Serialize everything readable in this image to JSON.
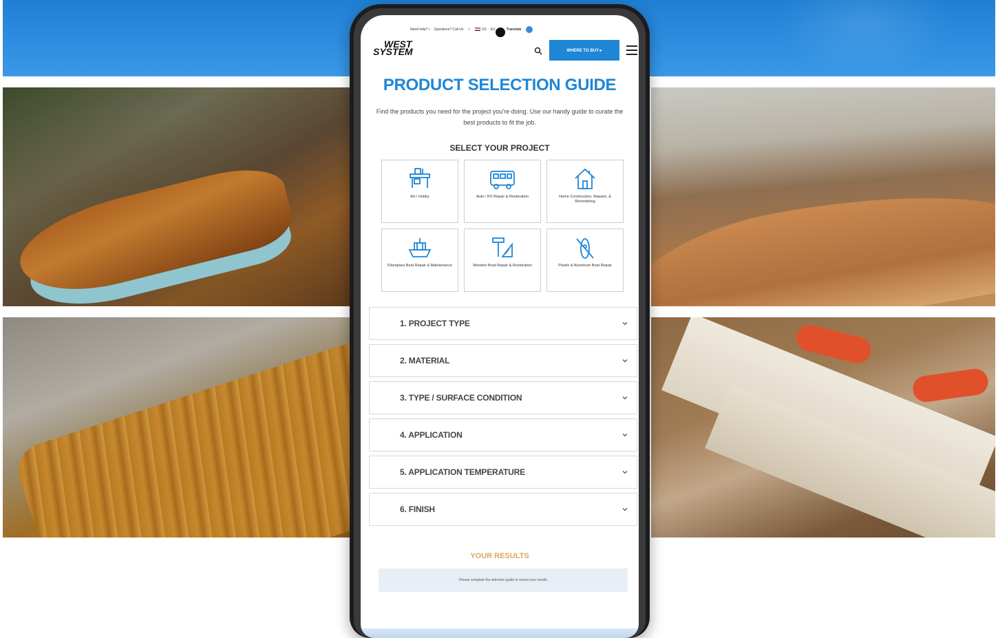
{
  "utility_bar": {
    "help": "Need help? •",
    "questions": "Questions? Call Us",
    "region_us": "US",
    "region_eu": "EU",
    "translate": "Translate"
  },
  "header": {
    "logo_line1": "WEST",
    "logo_line2": "SYSTEM",
    "buy_button": "WHERE TO BUY ▸"
  },
  "guide": {
    "title": "PRODUCT SELECTION GUIDE",
    "subtitle": "Find the products you need for the project you're doing. Use our handy guide to curate the best products to fit the job.",
    "select_label": "SELECT YOUR PROJECT",
    "projects": [
      {
        "label": "Art / Hobby",
        "icon": "workbench-icon"
      },
      {
        "label": "Auto / RV Repair & Restoration",
        "icon": "rv-icon"
      },
      {
        "label": "Home Construction, Repairs, & Remodeling",
        "icon": "house-icon"
      },
      {
        "label": "Fiberglass Boat Repair & Maintenance",
        "icon": "boat-icon"
      },
      {
        "label": "Wooden Boat Repair & Restoration",
        "icon": "hammer-icon"
      },
      {
        "label": "Plastic & Aluminum Boat Repair",
        "icon": "kayak-icon"
      }
    ],
    "steps": [
      "1. PROJECT TYPE",
      "2. MATERIAL",
      "3. TYPE / SURFACE CONDITION",
      "4. APPLICATION",
      "5. APPLICATION TEMPERATURE",
      "6. FINISH"
    ],
    "results_label": "YOUR RESULTS",
    "results_placeholder": "Please complete the selection guide to reveal your results"
  },
  "colors": {
    "brand_blue": "#1f86d6",
    "results_gold": "#d9a85c",
    "tile_border": "#c9cfd6"
  }
}
